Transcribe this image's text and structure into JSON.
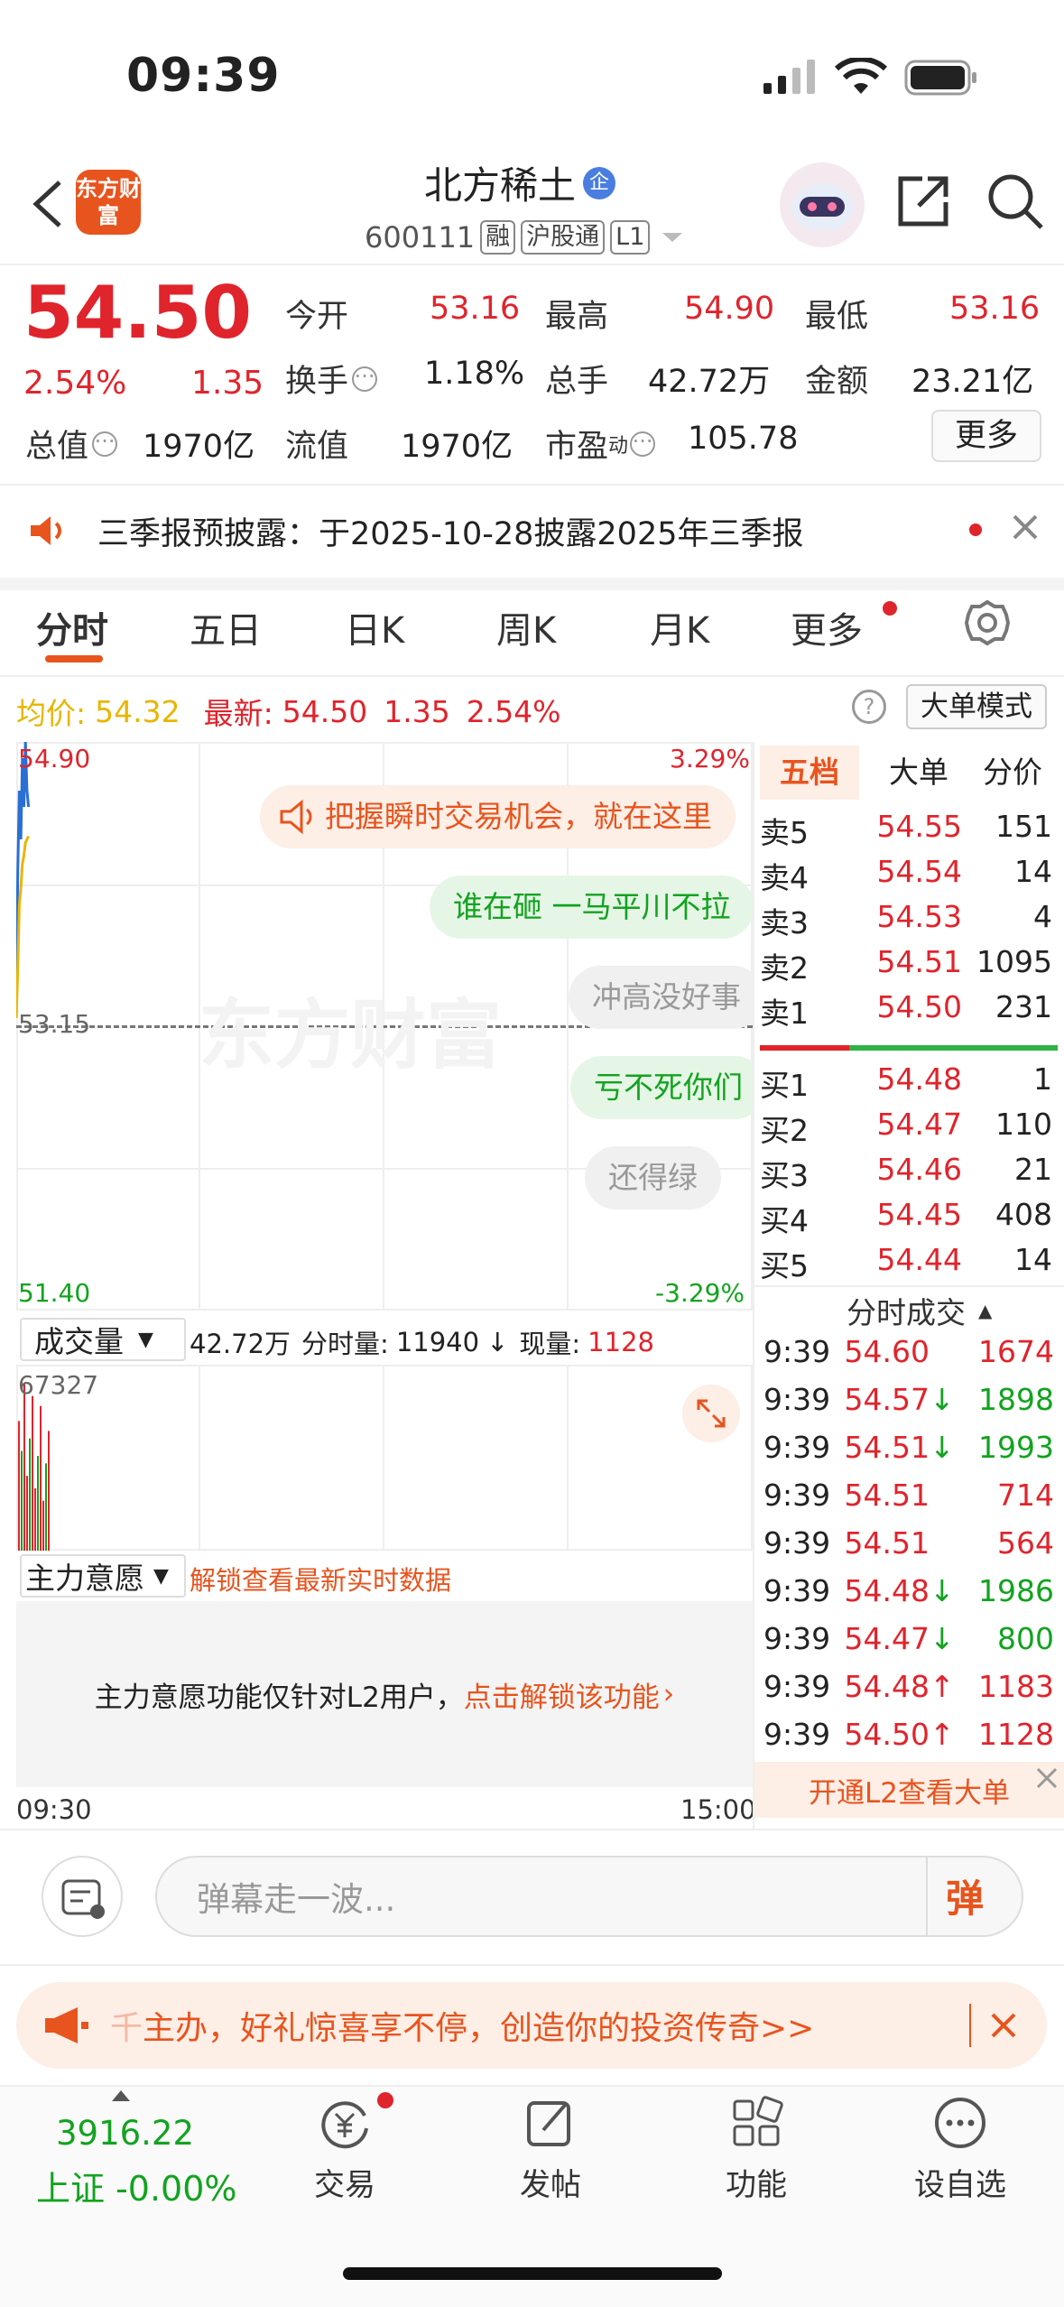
{
  "status_bar": {
    "time": "09:39"
  },
  "header": {
    "logo_text": "东方财富",
    "stock_name": "北方稀土",
    "badge": "企",
    "code": "600111",
    "tags": [
      "融",
      "沪股通",
      "L1"
    ]
  },
  "quote": {
    "price": "54.50",
    "change_pct": "2.54%",
    "change": "1.35",
    "open_label": "今开",
    "open": "53.16",
    "high_label": "最高",
    "high": "54.90",
    "low_label": "最低",
    "low": "53.16",
    "turnover_label": "换手",
    "turnover": "1.18%",
    "volume_label": "总手",
    "volume": "42.72万",
    "amount_label": "金额",
    "amount": "23.21亿",
    "mcap_label": "总值",
    "mcap": "1970亿",
    "float_label": "流值",
    "float": "1970亿",
    "pe_label": "市盈",
    "pe_sup": "动",
    "pe": "105.78",
    "more_button": "更多"
  },
  "notice": {
    "text": "三季报预披露：于2025-10-28披露2025年三季报"
  },
  "tabs": [
    "分时",
    "五日",
    "日K",
    "周K",
    "月K",
    "更多"
  ],
  "chart_header": {
    "avg_label": "均价:",
    "avg": "54.32",
    "latest_label": "最新:",
    "latest": "54.50",
    "chg": "1.35",
    "pct": "2.54%",
    "mode_button": "大单模式"
  },
  "chart_labels": {
    "top_price": "54.90",
    "top_pct": "3.29%",
    "mid_price": "53.15",
    "bottom_price": "51.40",
    "bottom_pct": "-3.29%",
    "watermark": "东方财富",
    "start_time": "09:30",
    "end_time": "15:00"
  },
  "danmaku": [
    "把握瞬时交易机会，就在这里",
    "谁在砸 一马平川不拉",
    "冲高没好事",
    "亏不死你们",
    "还得绿"
  ],
  "chart_data": {
    "type": "line",
    "ylim": [
      51.4,
      54.9
    ],
    "series": [
      {
        "values": [
          53.2,
          54.1,
          54.6,
          54.3,
          54.8,
          54.5,
          54.9,
          54.6,
          54.5
        ]
      },
      {
        "values": [
          53.2,
          53.5,
          53.9,
          54.0,
          54.15,
          54.2,
          54.28,
          54.3,
          54.32
        ]
      }
    ],
    "volume": {
      "max_label": "67327",
      "values": [
        52000,
        40000,
        67327,
        30000,
        45000,
        62000,
        25000,
        38000,
        58000,
        20000,
        35000,
        48000
      ]
    }
  },
  "volume_panel": {
    "selector": "成交量",
    "total": "42.72万",
    "per_label": "分时量:",
    "per": "11940",
    "now_label": "现量:",
    "now": "1128"
  },
  "main_force": {
    "selector": "主力意愿",
    "unlock_text": "解锁查看最新实时数据",
    "message": "主力意愿功能仅针对L2用户，",
    "message_link": "点击解锁该功能"
  },
  "order_book": {
    "tabs": [
      "五档",
      "大单",
      "分价"
    ],
    "sell": [
      {
        "label": "卖5",
        "price": "54.55",
        "vol": "151"
      },
      {
        "label": "卖4",
        "price": "54.54",
        "vol": "14"
      },
      {
        "label": "卖3",
        "price": "54.53",
        "vol": "4"
      },
      {
        "label": "卖2",
        "price": "54.51",
        "vol": "1095"
      },
      {
        "label": "卖1",
        "price": "54.50",
        "vol": "231"
      }
    ],
    "buy": [
      {
        "label": "买1",
        "price": "54.48",
        "vol": "1"
      },
      {
        "label": "买2",
        "price": "54.47",
        "vol": "110"
      },
      {
        "label": "买3",
        "price": "54.46",
        "vol": "21"
      },
      {
        "label": "买4",
        "price": "54.45",
        "vol": "408"
      },
      {
        "label": "买5",
        "price": "54.44",
        "vol": "14"
      }
    ],
    "trades_title": "分时成交",
    "trades": [
      {
        "t": "9:39",
        "p": "54.60",
        "a": "",
        "v": "1674",
        "c": "red"
      },
      {
        "t": "9:39",
        "p": "54.57",
        "a": "↓",
        "v": "1898",
        "c": "green"
      },
      {
        "t": "9:39",
        "p": "54.51",
        "a": "↓",
        "v": "1993",
        "c": "green"
      },
      {
        "t": "9:39",
        "p": "54.51",
        "a": "",
        "v": "714",
        "c": "red"
      },
      {
        "t": "9:39",
        "p": "54.51",
        "a": "",
        "v": "564",
        "c": "red"
      },
      {
        "t": "9:39",
        "p": "54.48",
        "a": "↓",
        "v": "1986",
        "c": "green"
      },
      {
        "t": "9:39",
        "p": "54.47",
        "a": "↓",
        "v": "800",
        "c": "green"
      },
      {
        "t": "9:39",
        "p": "54.48",
        "a": "↑",
        "v": "1183",
        "c": "red"
      },
      {
        "t": "9:39",
        "p": "54.50",
        "a": "↑",
        "v": "1128",
        "c": "red"
      }
    ],
    "l2_banner": "开通L2查看大单"
  },
  "comment": {
    "placeholder": "弹幕走一波...",
    "send": "弹"
  },
  "promo": {
    "text": "主办，好礼惊喜享不停，创造你的投资传奇>>",
    "prefix": "千"
  },
  "bottom_nav": {
    "index_value": "3916.22",
    "index_label": "上证 -0.00%",
    "items": [
      "交易",
      "发帖",
      "功能",
      "设自选"
    ]
  },
  "colors": {
    "up": "#e0242c",
    "down": "#12a31f",
    "accent": "#e8541d",
    "avg": "#e8b600"
  }
}
